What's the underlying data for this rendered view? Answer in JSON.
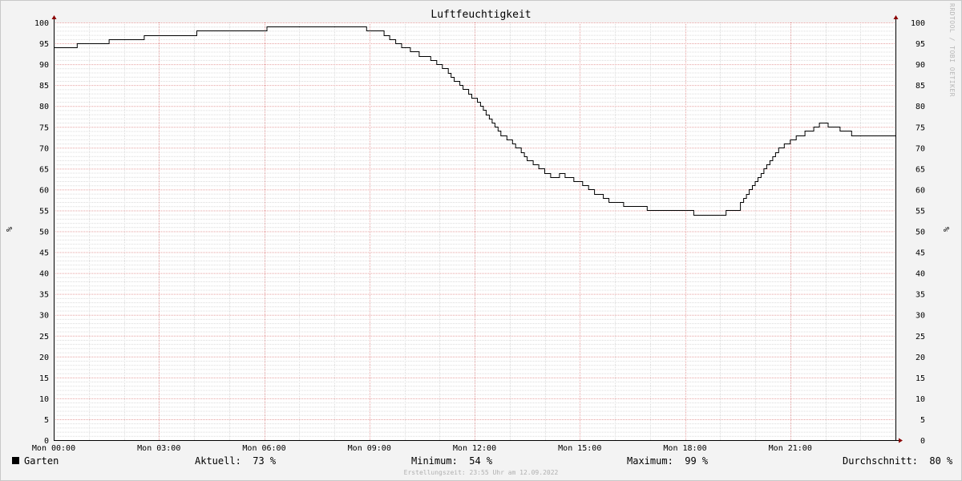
{
  "watermark": "RRDTOOL / TOBI OETIKER",
  "chart_data": {
    "type": "line",
    "title": "Luftfeuchtigkeit",
    "ylabel": "%",
    "ylim": [
      0,
      100
    ],
    "yticks": [
      0,
      5,
      10,
      15,
      20,
      25,
      30,
      35,
      40,
      45,
      50,
      55,
      60,
      65,
      70,
      75,
      80,
      85,
      90,
      95,
      100
    ],
    "xlim": [
      0,
      24
    ],
    "xticks": [
      {
        "x": 0,
        "label": "Mon 00:00"
      },
      {
        "x": 3,
        "label": "Mon 03:00"
      },
      {
        "x": 6,
        "label": "Mon 06:00"
      },
      {
        "x": 9,
        "label": "Mon 09:00"
      },
      {
        "x": 12,
        "label": "Mon 12:00"
      },
      {
        "x": 15,
        "label": "Mon 15:00"
      },
      {
        "x": 18,
        "label": "Mon 18:00"
      },
      {
        "x": 21,
        "label": "Mon 21:00"
      }
    ],
    "grid": true,
    "series": [
      {
        "name": "Garten",
        "color": "#000000",
        "x": [
          0,
          0.67,
          1.58,
          2.58,
          4.08,
          6.08,
          8.92,
          9.33,
          9.42,
          9.58,
          9.75,
          9.92,
          10.17,
          10.42,
          10.75,
          10.92,
          11.08,
          11.25,
          11.33,
          11.42,
          11.58,
          11.67,
          11.83,
          11.92,
          12.0,
          12.08,
          12.17,
          12.25,
          12.33,
          12.42,
          12.5,
          12.58,
          12.67,
          12.75,
          12.92,
          13.08,
          13.17,
          13.33,
          13.42,
          13.5,
          13.67,
          13.83,
          14.0,
          14.17,
          14.42,
          14.58,
          14.83,
          15.08,
          15.25,
          15.42,
          15.67,
          15.83,
          16.25,
          16.92,
          18.25,
          19.17,
          19.33,
          19.58,
          19.67,
          19.75,
          19.83,
          19.92,
          20.0,
          20.08,
          20.17,
          20.25,
          20.33,
          20.42,
          20.5,
          20.58,
          20.67,
          20.83,
          21.0,
          21.17,
          21.42,
          21.67,
          21.83,
          22.08,
          22.42,
          22.75,
          23.17,
          23.42,
          23.92
        ],
        "y": [
          94,
          95,
          96,
          97,
          98,
          99,
          98,
          98,
          97,
          96,
          95,
          94,
          93,
          92,
          91,
          90,
          89,
          88,
          87,
          86,
          85,
          84,
          83,
          82,
          82,
          81,
          80,
          79,
          78,
          77,
          76,
          75,
          74,
          73,
          72,
          71,
          70,
          69,
          68,
          67,
          66,
          65,
          64,
          63,
          64,
          63,
          62,
          61,
          60,
          59,
          58,
          57,
          56,
          55,
          54,
          55,
          55,
          57,
          58,
          59,
          60,
          61,
          62,
          63,
          64,
          65,
          66,
          67,
          68,
          69,
          70,
          71,
          72,
          73,
          74,
          75,
          76,
          75,
          74,
          73,
          73,
          73,
          73
        ]
      }
    ]
  },
  "legend": {
    "series": "Garten",
    "current": "Aktuell:  73 %",
    "minimum": "Minimum:  54 %",
    "maximum": "Maximum:  99 %",
    "average": "Durchschnitt:  80 %"
  },
  "footer": "Erstellungszeit: 23:55 Uhr am 12.09.2022"
}
